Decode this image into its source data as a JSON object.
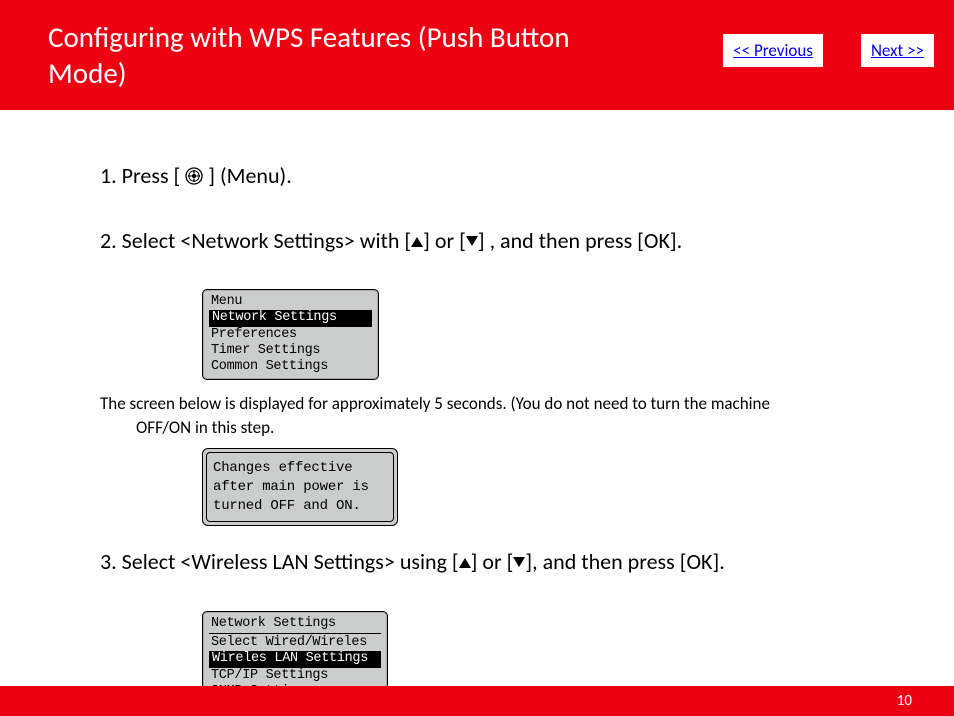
{
  "header": {
    "title": "Configuring with WPS Features (Push Button Mode)",
    "prev": "<< Previous",
    "next": "Next >>"
  },
  "steps": {
    "s1a": "1. Press [",
    "s1b": "] (Menu).",
    "s2a": "2. Select <Network Settings> with [",
    "s2mid": "] or [",
    "s2b": "] , and then press [OK].",
    "s3a": "3. Select <Wireless LAN Settings> using [",
    "s3mid": "] or [",
    "s3b": "], and then press [OK]."
  },
  "note": {
    "line1": "The screen below is displayed for approximately 5 seconds. (You do not need to turn the machine",
    "line2": "OFF/ON in this step."
  },
  "panel1": {
    "head": "Menu",
    "sel": "Network Settings",
    "l2": "Preferences",
    "l3": "Timer Settings",
    "l4": "Common Settings"
  },
  "panel2": {
    "l1": "Changes effective",
    "l2": "after main power is",
    "l3": "turned OFF and ON."
  },
  "panel3": {
    "head": "Network Settings",
    "l1": "Select Wired/Wireles",
    "sel": "Wireles LAN Settings",
    "l3": "TCP/IP Settings",
    "l4": "SNMP Settings"
  },
  "footer": {
    "page": "10"
  }
}
